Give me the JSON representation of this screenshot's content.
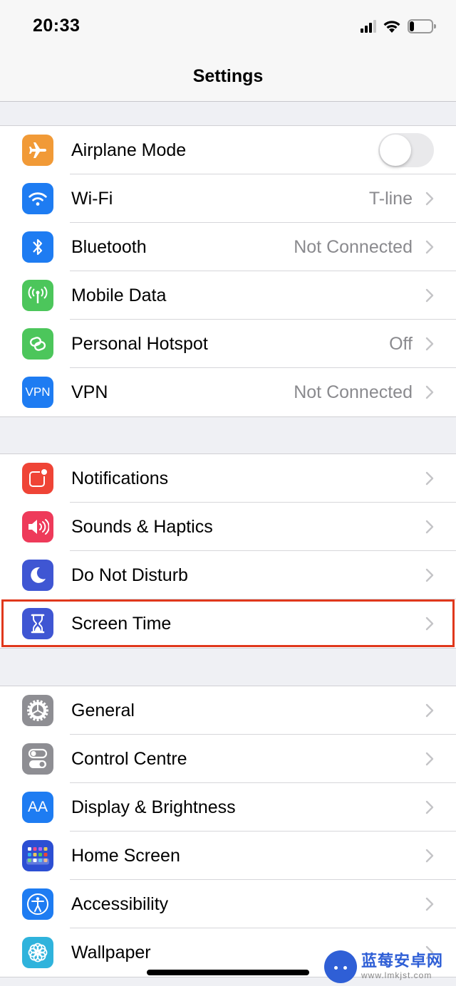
{
  "status_bar": {
    "time": "20:33",
    "signal_bars_active": 3,
    "signal_bars_total": 4,
    "battery_level_percent": 20
  },
  "nav": {
    "title": "Settings"
  },
  "groups": [
    {
      "rows": [
        {
          "id": "airplane-mode",
          "label": "Airplane Mode",
          "icon": "airplane-icon",
          "icon_color": "#f19a37",
          "control": "toggle",
          "toggle_on": false
        },
        {
          "id": "wifi",
          "label": "Wi-Fi",
          "icon": "wifi-icon",
          "icon_color": "#1e7cf2",
          "value": "T-line",
          "control": "chevron"
        },
        {
          "id": "bluetooth",
          "label": "Bluetooth",
          "icon": "bluetooth-icon",
          "icon_color": "#1e7cf2",
          "value": "Not Connected",
          "control": "chevron"
        },
        {
          "id": "mobile-data",
          "label": "Mobile Data",
          "icon": "antenna-icon",
          "icon_color": "#4cc65b",
          "value": "",
          "control": "chevron"
        },
        {
          "id": "personal-hotspot",
          "label": "Personal Hotspot",
          "icon": "hotspot-link-icon",
          "icon_color": "#4cc65b",
          "value": "Off",
          "control": "chevron"
        },
        {
          "id": "vpn",
          "label": "VPN",
          "icon": "vpn-icon",
          "icon_text": "VPN",
          "icon_color": "#1e7cf2",
          "value": "Not Connected",
          "control": "chevron"
        }
      ]
    },
    {
      "rows": [
        {
          "id": "notifications",
          "label": "Notifications",
          "icon": "notifications-icon",
          "icon_color": "#ef4436",
          "value": "",
          "control": "chevron"
        },
        {
          "id": "sounds-haptics",
          "label": "Sounds & Haptics",
          "icon": "speaker-icon",
          "icon_color": "#ee3a5a",
          "value": "",
          "control": "chevron"
        },
        {
          "id": "do-not-disturb",
          "label": "Do Not Disturb",
          "icon": "moon-icon",
          "icon_color": "#3f56d3",
          "value": "",
          "control": "chevron"
        },
        {
          "id": "screen-time",
          "label": "Screen Time",
          "icon": "hourglass-icon",
          "icon_color": "#3f56d3",
          "value": "",
          "control": "chevron",
          "highlighted": true
        }
      ]
    },
    {
      "rows": [
        {
          "id": "general",
          "label": "General",
          "icon": "gear-icon",
          "icon_color": "#8e8e93",
          "value": "",
          "control": "chevron"
        },
        {
          "id": "control-centre",
          "label": "Control Centre",
          "icon": "switches-icon",
          "icon_color": "#8e8e93",
          "value": "",
          "control": "chevron"
        },
        {
          "id": "display-brightness",
          "label": "Display & Brightness",
          "icon": "text-size-icon",
          "icon_text": "AA",
          "icon_color": "#1e7cf2",
          "value": "",
          "control": "chevron"
        },
        {
          "id": "home-screen",
          "label": "Home Screen",
          "icon": "app-grid-icon",
          "icon_color": "#2c4fd3",
          "value": "",
          "control": "chevron"
        },
        {
          "id": "accessibility",
          "label": "Accessibility",
          "icon": "accessibility-icon",
          "icon_color": "#1e7cf2",
          "value": "",
          "control": "chevron"
        },
        {
          "id": "wallpaper",
          "label": "Wallpaper",
          "icon": "flower-icon",
          "icon_color": "#2fb3dc",
          "value": "",
          "control": "chevron"
        }
      ]
    }
  ],
  "highlight_color": "#e0381c",
  "watermark": {
    "title": "蓝莓安卓网",
    "url": "www.lmkjst.com"
  }
}
